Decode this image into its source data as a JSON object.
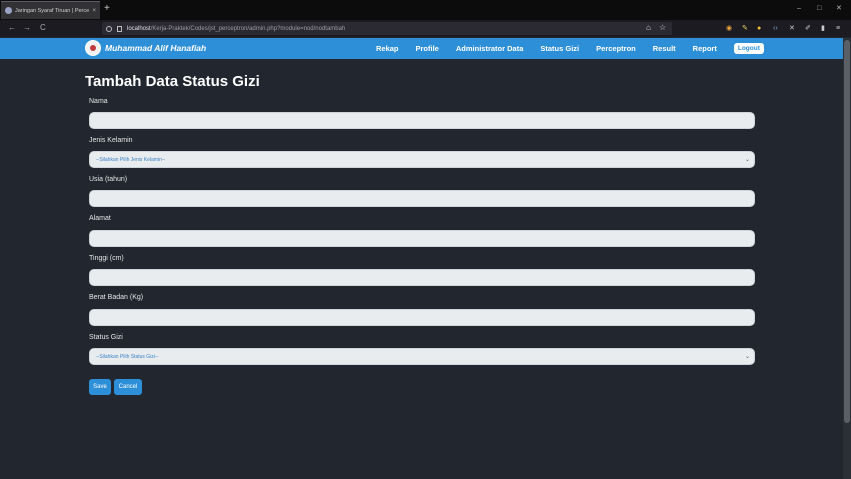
{
  "browser": {
    "tab_title": "Jaringan Syaraf Tiruan | Percept",
    "tab_close": "×",
    "new_tab": "+",
    "window_controls": [
      "–",
      "□",
      "✕"
    ],
    "url_host": "localhost",
    "url_path": "/Kerja-Praktek/Codes/jst_perceptron/admin.php?module=nod/nodtambah",
    "bookmark_star": "☆",
    "back": "←",
    "forward": "→",
    "reload": "C"
  },
  "header": {
    "brand": "Muhammad Alif Hanafiah",
    "menu": [
      "Rekap",
      "Profile",
      "Administrator Data",
      "Status Gizi",
      "Perceptron",
      "Result",
      "Report"
    ],
    "logout": "Logout"
  },
  "form": {
    "title": "Tambah Data Status Gizi",
    "nama_label": "Nama",
    "jenis_kelamin_label": "Jenis Kelamin",
    "jenis_kelamin_placeholder": "--Silahkan Pilih Jenis Kelamin--",
    "usia_label": "Usia (tahun)",
    "alamat_label": "Alamat",
    "tinggi_label": "Tinggi (cm)",
    "berat_label": "Berat Badan (Kg)",
    "status_gizi_label": "Status Gizi",
    "status_gizi_placeholder": "--Silahkan Pilih Status Gizi--",
    "save": "Save",
    "cancel": "Cancel"
  },
  "colors": {
    "accent": "#2d8fd8",
    "background": "#22262e",
    "input_bg": "#e9ecef"
  }
}
